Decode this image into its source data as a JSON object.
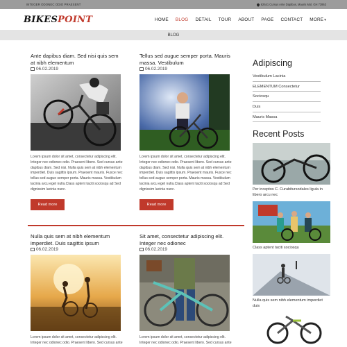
{
  "topbar": {
    "left_text": "INTEGER ODONEC ODIO PRAESENT",
    "address": "62641 Cursus Ante Dapibus, Mauris Mol, GH 73953"
  },
  "header": {
    "logo_part1": "BIKES",
    "logo_part2": "POINT",
    "nav": [
      "HOME",
      "BLOG",
      "DETAIL",
      "TOUR",
      "ABOUT",
      "PAGE",
      "CONTACT",
      "MORE"
    ],
    "active": "BLOG"
  },
  "breadcrumb": "BLOG",
  "posts": [
    {
      "title": "Ante dapibus diam. Sed nisi quis sem at nibh elementum",
      "date": "06.02.2019",
      "text": "Lorem ipsum dolor sit amet, consectetur adipiscing elit. Integer nec odionec odio. Praesent libero. Sed cursus ante dapibus diam. Sed nisi. Nulla quis sem at nibh elementum imperdiet. Duis sagittis ipsum. Praesent mauris. Fusce nec tellus sed augue semper porta. Mauris massa. Vestibulum lacinia arcu eget nulla.Class aptent taciti sociosqu ad Sed dignissim lacinia nunc.",
      "button": "Read more"
    },
    {
      "title": "Tellus sed augue semper porta. Mauris massa. Vestibulum",
      "date": "06.02.2019",
      "text": "Lorem ipsum dolor sit amet, consectetur adipiscing elit. Integer nec odionec odio. Praesent libero. Sed cursus ante dapibus diam. Sed nisi. Nulla quis sem at nibh elementum imperdiet. Duis sagittis ipsum. Praesent mauris. Fusce nec tellus sed augue semper porta. Mauris massa. Vestibulum lacinia arcu eget nulla.Class aptent taciti sociosqu ad Sed dignissim lacinia nunc.",
      "button": "Read more"
    },
    {
      "title": "Nulla quis sem at nibh elementum imperdiet. Duis sagittis ipsum",
      "date": "06.02.2019",
      "text": "Lorem ipsum dolor sit amet, consectetur adipiscing elit. Integer nec odionec odio. Praesent libero. Sed cursus ante"
    },
    {
      "title": "Sit amet, consectetur adipiscing elit. Integer nec odionec",
      "date": "06.02.2019",
      "text": "Lorem ipsum dolor sit amet, consectetur adipiscing elit. Integer nec odionec odio. Praesent libero. Sed cursus ante"
    }
  ],
  "sidebar": {
    "title": "Adipiscing",
    "items": [
      "Vestibulum Lacinia",
      "ELEMENTUM Consectetur",
      "Sociosqu",
      "Duis",
      "Mauris Massa"
    ]
  },
  "recent": {
    "title": "Recent Posts",
    "items": [
      "Per inceptos C. Curabitursodales ligula in libero arcu nec",
      "Class aptent taciti sociosqu",
      "Nulla quis sem nibh elementum imperdiet duis"
    ]
  },
  "colors": {
    "accent": "#c0392b",
    "topbar": "#9c9c9c",
    "crumb": "#e4e4e4"
  }
}
